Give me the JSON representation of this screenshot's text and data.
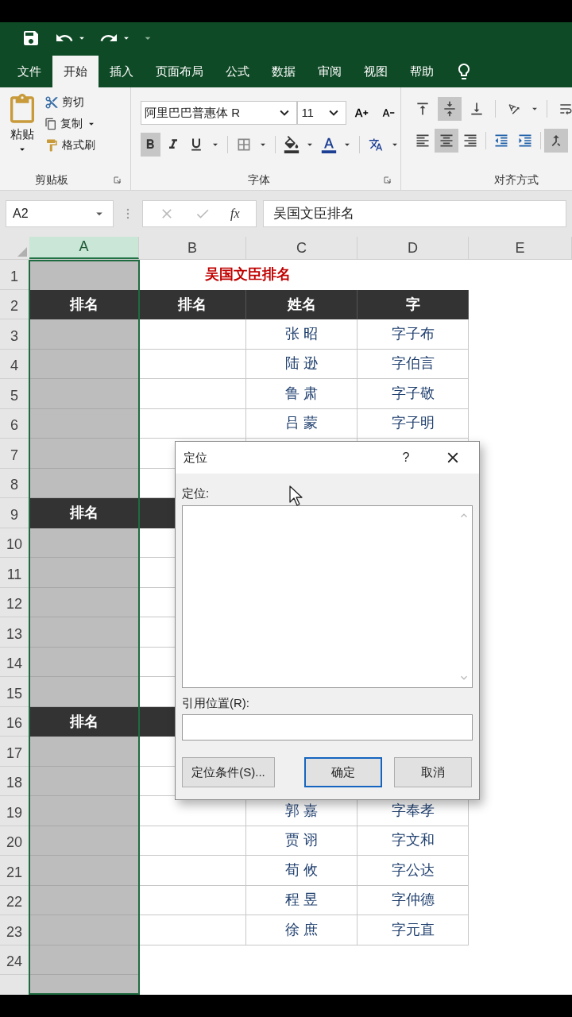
{
  "tabs": [
    {
      "label": "文件",
      "selected": false
    },
    {
      "label": "开始",
      "selected": true
    },
    {
      "label": "插入",
      "selected": false
    },
    {
      "label": "页面布局",
      "selected": false
    },
    {
      "label": "公式",
      "selected": false
    },
    {
      "label": "数据",
      "selected": false
    },
    {
      "label": "审阅",
      "selected": false
    },
    {
      "label": "视图",
      "selected": false
    },
    {
      "label": "帮助",
      "selected": false
    }
  ],
  "ribbon": {
    "clipboard": {
      "paste": "粘贴",
      "cut": "剪切",
      "copy": "复制",
      "format_painter": "格式刷",
      "group": "剪贴板"
    },
    "font": {
      "name": "阿里巴巴普惠体 R",
      "size": "11",
      "group": "字体",
      "styles": [
        {
          "kind": "bold",
          "on": true
        },
        {
          "kind": "italic",
          "on": false
        },
        {
          "kind": "underline",
          "on": false
        }
      ]
    },
    "alignment": {
      "group": "对齐方式",
      "vertical": [
        {
          "kind": "top",
          "on": false
        },
        {
          "kind": "middle",
          "on": true
        },
        {
          "kind": "bottom",
          "on": false
        }
      ],
      "horizontal": [
        {
          "kind": "left",
          "on": false
        },
        {
          "kind": "center",
          "on": true
        },
        {
          "kind": "right",
          "on": false
        }
      ]
    }
  },
  "formula_bar": {
    "name_box": "A2",
    "fx": "fx",
    "content": "吴国文臣排名"
  },
  "sheet": {
    "columns": [
      {
        "label": "A",
        "selected": true
      },
      {
        "label": "B",
        "selected": false
      },
      {
        "label": "C",
        "selected": false
      },
      {
        "label": "D",
        "selected": false
      },
      {
        "label": "E",
        "selected": false
      }
    ],
    "rows": [
      {
        "number": "1",
        "kind": "title",
        "title": "吴国文臣排名"
      },
      {
        "number": "2",
        "kind": "table",
        "cells": [
          {
            "kind": "header",
            "text": "排名"
          },
          {
            "kind": "header",
            "text": "排名"
          },
          {
            "kind": "header",
            "text": "姓名"
          },
          {
            "kind": "header",
            "text": "字"
          }
        ]
      },
      {
        "number": "3",
        "kind": "table",
        "cells": [
          {
            "kind": "blank"
          },
          {
            "kind": "blank"
          },
          {
            "kind": "data",
            "text": "张 昭"
          },
          {
            "kind": "data",
            "text": "字子布"
          }
        ]
      },
      {
        "number": "4",
        "kind": "table",
        "cells": [
          {
            "kind": "blank"
          },
          {
            "kind": "blank"
          },
          {
            "kind": "data",
            "text": "陆 逊"
          },
          {
            "kind": "data",
            "text": "字伯言"
          }
        ]
      },
      {
        "number": "5",
        "kind": "table",
        "cells": [
          {
            "kind": "blank"
          },
          {
            "kind": "blank"
          },
          {
            "kind": "data",
            "text": "鲁 肃"
          },
          {
            "kind": "data",
            "text": "字子敬"
          }
        ]
      },
      {
        "number": "6",
        "kind": "table",
        "cells": [
          {
            "kind": "blank"
          },
          {
            "kind": "blank"
          },
          {
            "kind": "data",
            "text": "吕 蒙"
          },
          {
            "kind": "data",
            "text": "字子明"
          }
        ]
      },
      {
        "number": "7",
        "kind": "table",
        "cells": [
          {
            "kind": "blank"
          },
          {
            "kind": "blank"
          }
        ]
      },
      {
        "number": "8",
        "kind": "table",
        "cells": [
          {
            "kind": "blank"
          },
          {
            "kind": "blank"
          }
        ]
      },
      {
        "number": "9",
        "kind": "table",
        "cells": [
          {
            "kind": "header",
            "text": "排名"
          },
          {
            "kind": "header"
          }
        ]
      },
      {
        "number": "10",
        "kind": "table",
        "cells": [
          {
            "kind": "blank"
          },
          {
            "kind": "blank"
          }
        ]
      },
      {
        "number": "11",
        "kind": "table",
        "cells": [
          {
            "kind": "blank"
          },
          {
            "kind": "blank"
          }
        ]
      },
      {
        "number": "12",
        "kind": "table",
        "cells": [
          {
            "kind": "blank"
          },
          {
            "kind": "blank"
          }
        ]
      },
      {
        "number": "13",
        "kind": "table",
        "cells": [
          {
            "kind": "blank"
          },
          {
            "kind": "blank"
          }
        ]
      },
      {
        "number": "14",
        "kind": "table",
        "cells": [
          {
            "kind": "blank"
          },
          {
            "kind": "blank"
          }
        ]
      },
      {
        "number": "15",
        "kind": "table",
        "cells": [
          {
            "kind": "blank"
          },
          {
            "kind": "blank"
          }
        ]
      },
      {
        "number": "16",
        "kind": "table",
        "cells": [
          {
            "kind": "header",
            "text": "排名"
          },
          {
            "kind": "header"
          }
        ]
      },
      {
        "number": "17",
        "kind": "table",
        "cells": [
          {
            "kind": "blank"
          },
          {
            "kind": "blank"
          }
        ]
      },
      {
        "number": "18",
        "kind": "table",
        "cells": [
          {
            "kind": "blank"
          },
          {
            "kind": "blank"
          }
        ]
      },
      {
        "number": "19",
        "kind": "table",
        "cells": [
          {
            "kind": "blank"
          },
          {
            "kind": "blank"
          },
          {
            "kind": "data",
            "text": "郭 嘉"
          },
          {
            "kind": "data",
            "text": "字奉孝"
          }
        ]
      },
      {
        "number": "20",
        "kind": "table",
        "cells": [
          {
            "kind": "blank"
          },
          {
            "kind": "blank"
          },
          {
            "kind": "data",
            "text": "贾 诩"
          },
          {
            "kind": "data",
            "text": "字文和"
          }
        ]
      },
      {
        "number": "21",
        "kind": "table",
        "cells": [
          {
            "kind": "blank"
          },
          {
            "kind": "blank"
          },
          {
            "kind": "data",
            "text": "荀 攸"
          },
          {
            "kind": "data",
            "text": "字公达"
          }
        ]
      },
      {
        "number": "22",
        "kind": "table",
        "cells": [
          {
            "kind": "blank"
          },
          {
            "kind": "blank"
          },
          {
            "kind": "data",
            "text": "程 昱"
          },
          {
            "kind": "data",
            "text": "字仲德"
          }
        ]
      },
      {
        "number": "23",
        "kind": "table",
        "cells": [
          {
            "kind": "blank"
          },
          {
            "kind": "blank"
          },
          {
            "kind": "data",
            "text": "徐 庶"
          },
          {
            "kind": "data",
            "text": "字元直"
          }
        ]
      },
      {
        "number": "24",
        "kind": "plain"
      }
    ]
  },
  "dialog": {
    "title": "定位",
    "help": "?",
    "list_label": "定位:",
    "reference_label": "引用位置(R):",
    "buttons": [
      {
        "kind": "special",
        "label": "定位条件(S)..."
      },
      {
        "kind": "default",
        "label": "确定"
      },
      {
        "kind": "normal",
        "label": "取消"
      }
    ]
  }
}
